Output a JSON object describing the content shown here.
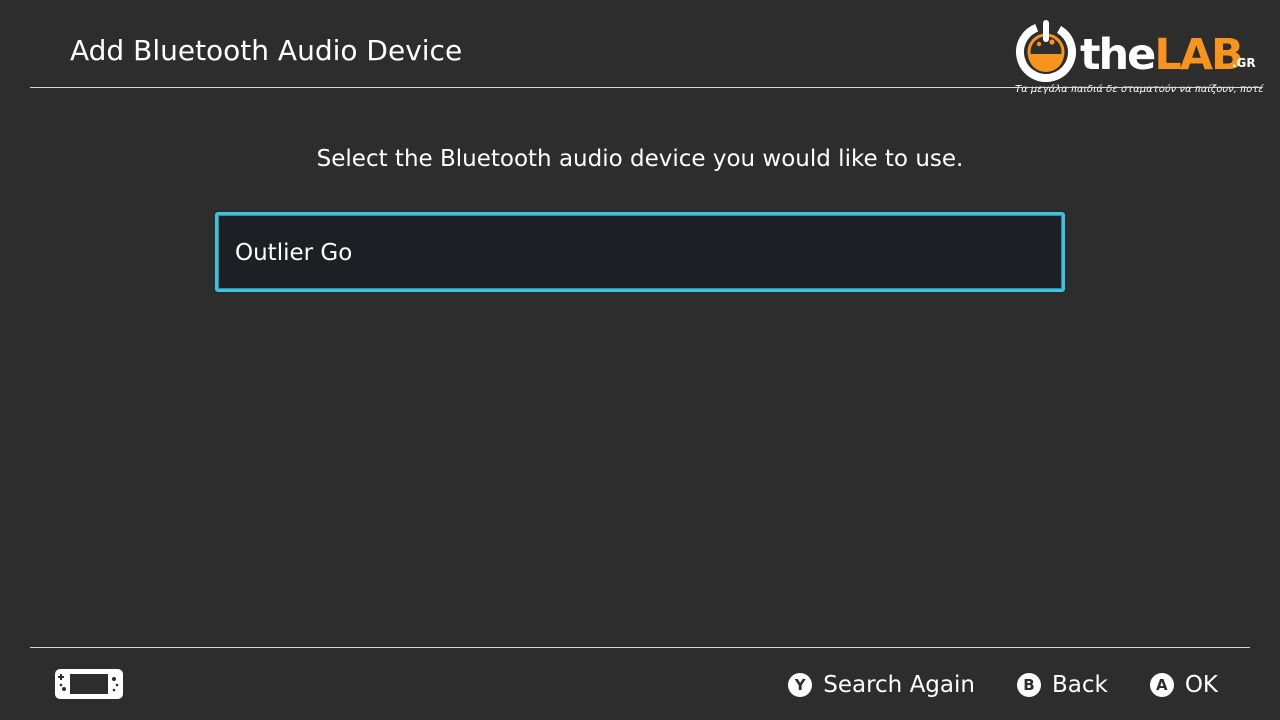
{
  "header": {
    "title": "Add Bluetooth Audio Device"
  },
  "watermark": {
    "brand_the": "the",
    "brand_lab": "LAB",
    "brand_suffix": ".GR",
    "tagline": "Τα μεγάλα παιδιά δε σταματούν να παίζουν, ποτέ",
    "accent_color": "#f7941d"
  },
  "main": {
    "instruction": "Select the Bluetooth audio device you would like to use.",
    "devices": [
      {
        "name": "Outlier Go",
        "selected": true
      }
    ],
    "selection_color": "#3fc3dc"
  },
  "footer": {
    "console_icon": "handheld-console-icon",
    "actions": [
      {
        "button": "Y",
        "label": "Search Again"
      },
      {
        "button": "B",
        "label": "Back"
      },
      {
        "button": "A",
        "label": "OK"
      }
    ]
  },
  "colors": {
    "background": "#2d2d2d",
    "text": "#ffffff",
    "rule": "#d8d8d8"
  }
}
